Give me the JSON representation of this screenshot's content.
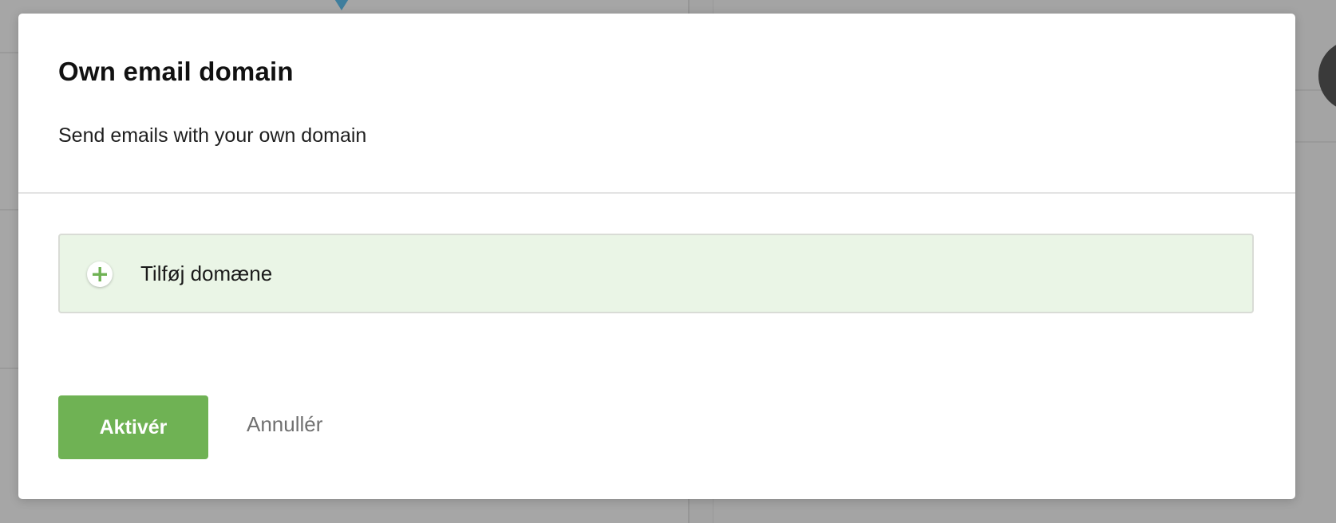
{
  "modal": {
    "title": "Own email domain",
    "subtitle": "Send emails with your own domain",
    "add_domain": {
      "label": "Tilføj domæne",
      "icon": "plus-icon"
    },
    "actions": {
      "activate_label": "Aktivér",
      "cancel_label": "Annullér"
    }
  },
  "colors": {
    "accent_green": "#6fb254",
    "add_domain_background": "#eaf5e6",
    "overlay": "#a3a3a3",
    "background_marker": "#3f7e9d"
  }
}
